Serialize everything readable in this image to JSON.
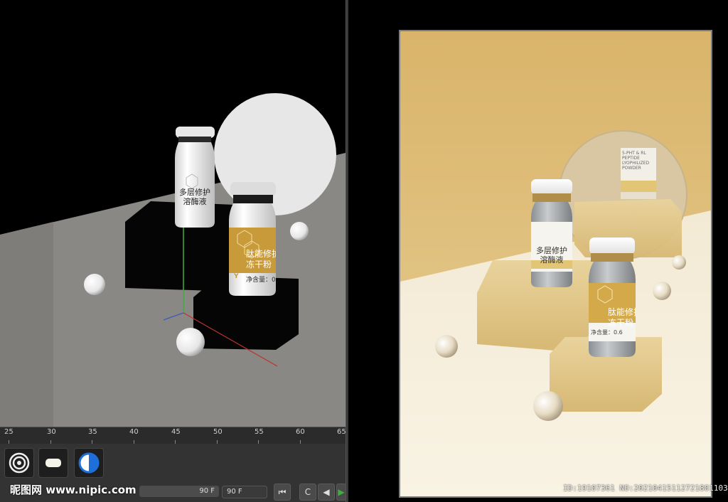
{
  "viewport": {
    "bottle_back": {
      "line1": "多层修护",
      "line2": "溶酶液"
    },
    "bottle_front": {
      "line1": "肽能修护",
      "line2": "冻干粉",
      "net": "净含量：0.",
      "mark": "Y"
    }
  },
  "timeline": {
    "ticks": [
      "25",
      "30",
      "35",
      "40",
      "45",
      "50",
      "55",
      "60",
      "65"
    ]
  },
  "toolbar": {
    "buttons": [
      "light-target-icon",
      "area-light-icon",
      "half-moon-icon"
    ],
    "end_frame_1": "90 F",
    "end_frame_2": "90 F",
    "playback": [
      "⏮",
      "C",
      "◀",
      "▶"
    ]
  },
  "watermark_left": "昵图网 www.nipic.com",
  "render": {
    "bottle_left": {
      "line1": "多层修护",
      "line2": "溶酶液"
    },
    "bottle_right": {
      "line1": "肽能修护",
      "line2": "冻干粉",
      "net": "净含量：0.6"
    },
    "mirror_label": "5-PHT & RL\nPEPTIDE\nLYOPHILIZED\nPOWDER"
  },
  "watermark_right": "ID:19107361 NO:20210415112721801103",
  "colors": {
    "accent_gold": "#c99a3a",
    "ui_dark": "#333333",
    "render_bg": "#e2c57f"
  }
}
